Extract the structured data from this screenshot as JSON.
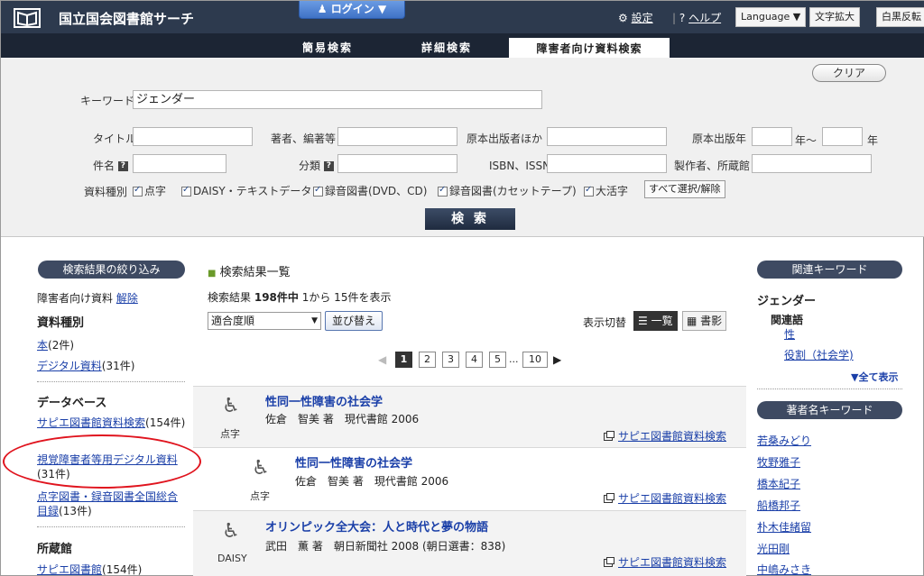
{
  "header": {
    "site_title": "国立国会図書館サーチ",
    "login_label": "ログイン",
    "settings_label": "設定",
    "help_label": "ヘルプ",
    "language_label": "Language",
    "font_enlarge_label": "文字拡大",
    "contrast_label": "白黒反転"
  },
  "tabs": [
    {
      "label": "簡易検索"
    },
    {
      "label": "詳細検索"
    },
    {
      "label": "障害者向け資料検索",
      "active": true
    }
  ],
  "search_form": {
    "clear_label": "クリア",
    "keyword_label": "キーワード",
    "keyword_value": "ジェンダー",
    "title_label": "タイトル",
    "author_label": "著者、編著等",
    "orig_publisher_label": "原本出版者ほか",
    "orig_year_label": "原本出版年",
    "year_from_suffix": "年〜",
    "year_to_suffix": "年",
    "subject_label": "件名",
    "classification_label": "分類",
    "isbn_label": "ISBN、ISSN",
    "producer_label": "製作者、所蔵館",
    "material_type_label": "資料種別",
    "material_types": [
      "点字",
      "DAISY・テキストデータ",
      "録音図書(DVD、CD)",
      "録音図書(カセットテープ)",
      "大活字"
    ],
    "select_all_label": "すべて選択/解除",
    "search_button_label": "検 索"
  },
  "left_sidebar": {
    "refine_title": "検索結果の絞り込み",
    "filter_text": "障害者向け資料",
    "filter_release": "解除",
    "material_heading": "資料種別",
    "materials": [
      {
        "link": "本",
        "count": "(2件)"
      },
      {
        "link": "デジタル資料",
        "count": "(31件)"
      }
    ],
    "database_heading": "データベース",
    "databases": [
      {
        "link": "サピエ図書館資料検索",
        "count": "(154件)"
      },
      {
        "link": "視覚障害者等用デジタル資料",
        "count": "(31件)"
      },
      {
        "link": "点字図書・録音図書全国総合目録",
        "count": "(13件)"
      }
    ],
    "holdings_heading": "所蔵館",
    "holdings": [
      {
        "link": "サピエ図書館",
        "count": "(154件)"
      }
    ]
  },
  "results": {
    "heading": "検索結果一覧",
    "summary_prefix": "検索結果",
    "total": "198件中",
    "range": "1から 15件を表示",
    "sort_value": "適合度順",
    "sort_button": "並び替え",
    "view_label": "表示切替",
    "view_list": "一覧",
    "view_cover": "書影",
    "pages": [
      "1",
      "2",
      "3",
      "4",
      "5",
      "...",
      "10"
    ],
    "items": [
      {
        "title": "性同一性障害の社会学",
        "meta": "佐倉　智美 著　現代書館 2006",
        "type": "点字",
        "source": "サピエ図書館資料検索"
      },
      {
        "title": "性同一性障害の社会学",
        "meta": "佐倉　智美 著　現代書館 2006",
        "type": "点字",
        "source": "サピエ図書館資料検索"
      },
      {
        "title": "オリンピック全大会：人と時代と夢の物語",
        "meta": "武田　薫 著　朝日新聞社 2008 (朝日選書：838)",
        "type": "DAISY",
        "source": "サピエ図書館資料検索"
      }
    ]
  },
  "right_sidebar": {
    "related_title": "関連キーワード",
    "keyword": "ジェンダー",
    "related_heading": "関連語",
    "related_terms": [
      "性",
      "役割（社会学)"
    ],
    "show_all": "▼全て表示",
    "author_title": "著者名キーワード",
    "authors": [
      "若桑みどり",
      "牧野雅子",
      "橋本紀子",
      "船橋邦子",
      "朴木佳緒留",
      "光田剛",
      "中嶋みさき"
    ]
  }
}
